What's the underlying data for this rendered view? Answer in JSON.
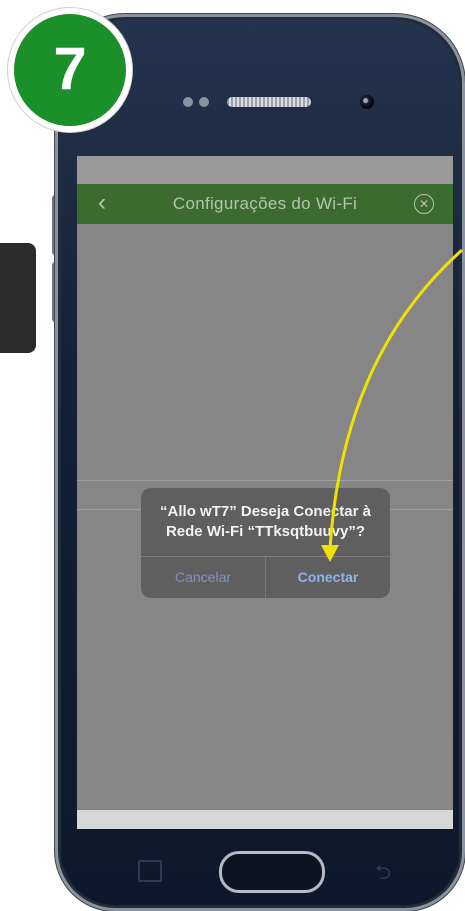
{
  "step_badge": {
    "number": "7"
  },
  "app": {
    "title": "Configurações do Wi-Fi",
    "back_icon": "chevron-left-icon",
    "close_icon": "close-circle-icon",
    "accent_color": "#3c6b30"
  },
  "dialog": {
    "message_line1": "“Allo wT7” Deseja Conectar à",
    "message_line2": "Rede Wi-Fi “TTksqtbuuvy”?",
    "cancel_label": "Cancelar",
    "connect_label": "Conectar"
  },
  "annotation": {
    "arrow_color": "#f0e200",
    "points_to": "Conectar"
  },
  "nav": {
    "recents_icon": "recents-icon",
    "home_icon": "home-button",
    "back_icon": "back-arrow-icon"
  }
}
